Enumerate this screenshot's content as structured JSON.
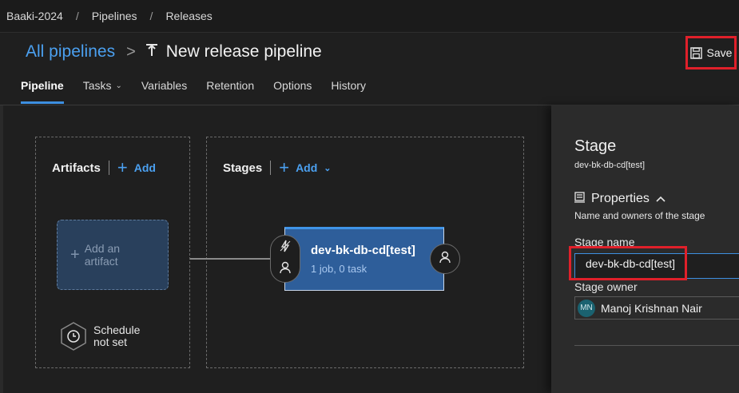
{
  "breadcrumb": {
    "project": "Baaki-2024",
    "section": "Pipelines",
    "page": "Releases",
    "separator": "/"
  },
  "header": {
    "all_pipelines": "All pipelines",
    "chevron": ">",
    "pipeline_title": "New release pipeline",
    "save_label": "Save"
  },
  "tabs": [
    {
      "label": "Pipeline"
    },
    {
      "label": "Tasks",
      "has_dropdown": true
    },
    {
      "label": "Variables"
    },
    {
      "label": "Retention"
    },
    {
      "label": "Options"
    },
    {
      "label": "History"
    }
  ],
  "artifacts": {
    "heading": "Artifacts",
    "add_label": "Add",
    "placeholder_line1": "Add an",
    "placeholder_line2": "artifact",
    "schedule_line1": "Schedule",
    "schedule_line2": "not set"
  },
  "stages": {
    "heading": "Stages",
    "add_label": "Add",
    "stage": {
      "name": "dev-bk-db-cd[test]",
      "summary": "1 job, 0 task"
    }
  },
  "panel": {
    "title": "Stage",
    "subtitle": "dev-bk-db-cd[test]",
    "properties_heading": "Properties",
    "properties_sub": "Name and owners of the stage",
    "stage_name_label": "Stage name",
    "stage_name_value": "dev-bk-db-cd[test]",
    "stage_owner_label": "Stage owner",
    "owner_initials": "MN",
    "owner_name": "Manoj Krishnan Nair"
  },
  "colors": {
    "accent": "#3d8fe0",
    "link": "#4ba0f0",
    "stage_fill": "#2e5e9a",
    "highlight": "#e0202a",
    "avatar": "#1a6270"
  }
}
